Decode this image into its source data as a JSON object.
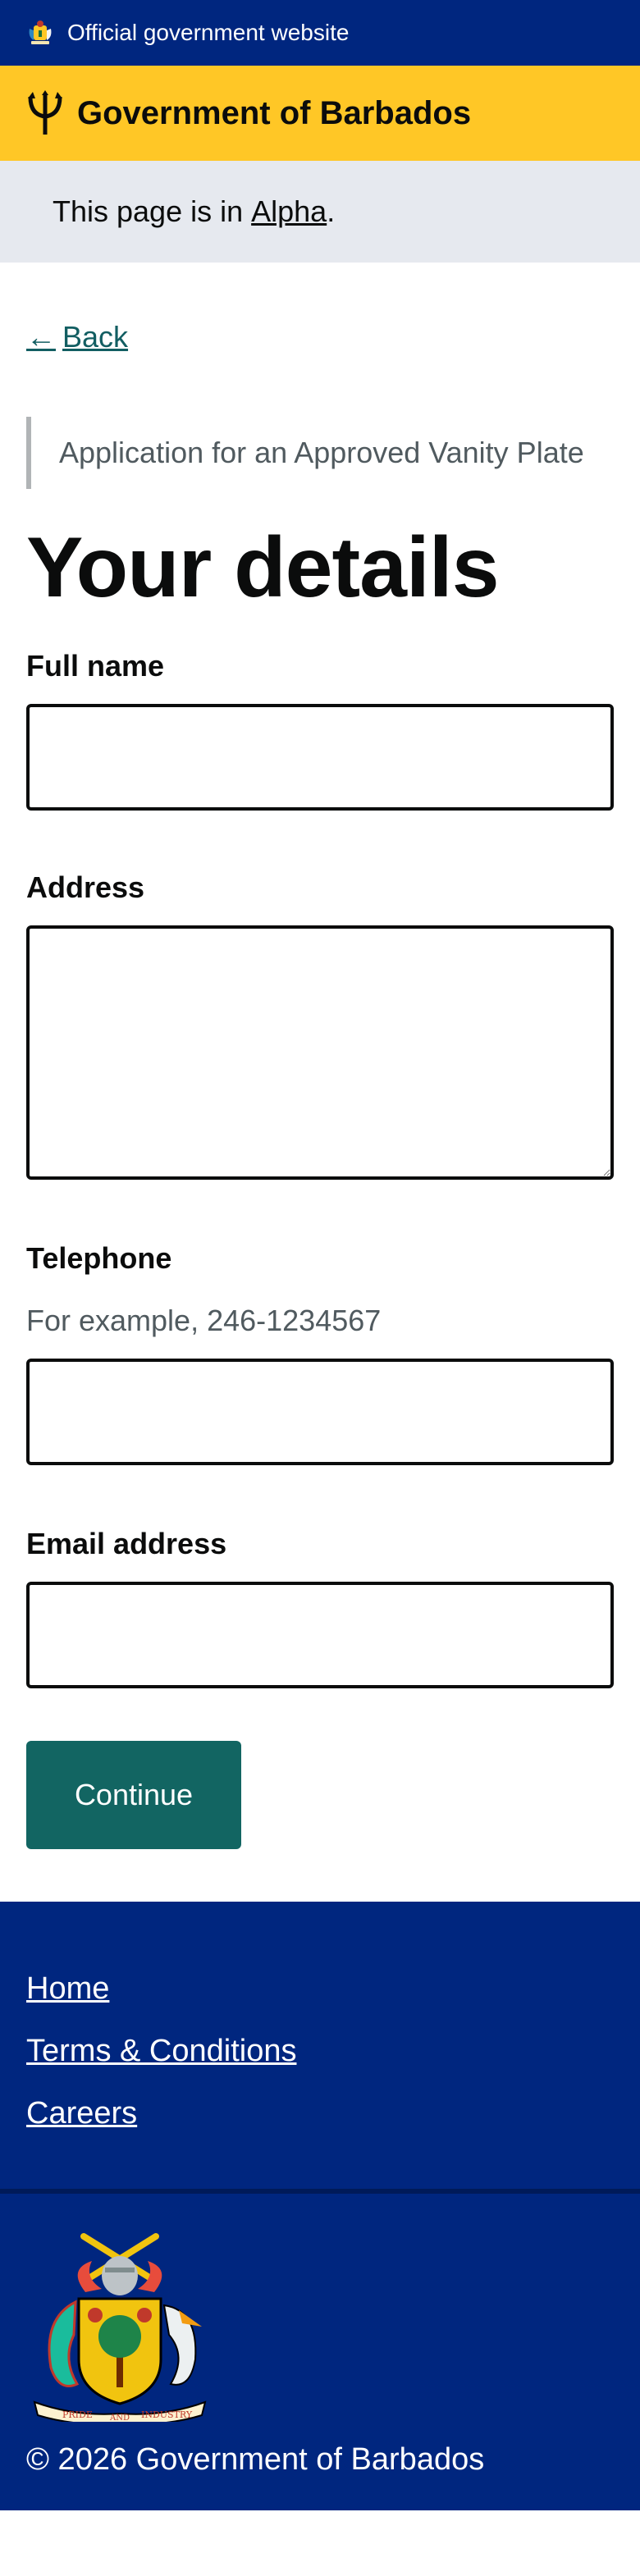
{
  "topbar": {
    "official_text": "Official government website"
  },
  "brand": {
    "name": "Government of Barbados"
  },
  "phase": {
    "prefix": "This page is in ",
    "link": "Alpha",
    "suffix": "."
  },
  "back": {
    "label": "Back"
  },
  "form": {
    "caption": "Application for an Approved Vanity Plate",
    "title": "Your details",
    "fields": {
      "full_name": {
        "label": "Full name",
        "value": ""
      },
      "address": {
        "label": "Address",
        "value": ""
      },
      "telephone": {
        "label": "Telephone",
        "hint": "For example, 246-1234567",
        "value": ""
      },
      "email": {
        "label": "Email address",
        "value": ""
      }
    },
    "continue_label": "Continue"
  },
  "footer": {
    "links": [
      "Home",
      "Terms & Conditions",
      "Careers"
    ],
    "crest_motto": [
      "PRIDE",
      "AND",
      "INDUSTRY"
    ],
    "copyright": "© 2026 Government of Barbados"
  },
  "colors": {
    "header_blue": "#00267f",
    "brand_yellow": "#ffc726",
    "phase_gray": "#e6e9ef",
    "link_teal": "#125e62",
    "button_teal": "#126562"
  },
  "icons": {
    "topbar": "coat-of-arms-icon",
    "brand": "trident-icon",
    "back": "arrow-left-icon",
    "footer": "coat-of-arms-icon"
  }
}
